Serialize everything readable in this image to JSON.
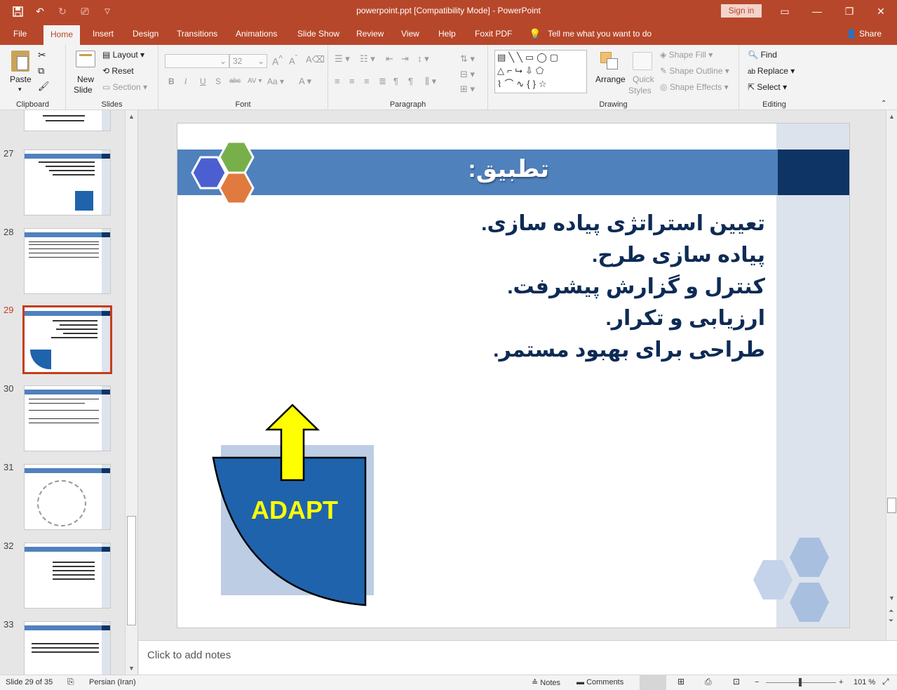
{
  "window": {
    "doc_title": "powerpoint.ppt [Compatibility Mode]  -  PowerPoint",
    "signin": "Sign in"
  },
  "tabs": [
    "File",
    "Home",
    "Insert",
    "Design",
    "Transitions",
    "Animations",
    "Slide Show",
    "Review",
    "View",
    "Help",
    "Foxit PDF",
    "Tell me what you want to do"
  ],
  "share": "Share",
  "ribbon": {
    "clipboard": {
      "paste": "Paste",
      "label": "Clipboard"
    },
    "slides": {
      "new_slide_1": "New",
      "new_slide_2": "Slide",
      "layout": "Layout",
      "reset": "Reset",
      "section": "Section",
      "label": "Slides"
    },
    "font": {
      "size": "32",
      "label": "Font"
    },
    "paragraph": {
      "label": "Paragraph"
    },
    "drawing": {
      "arrange": "Arrange",
      "quick_styles_1": "Quick",
      "quick_styles_2": "Styles",
      "shape_fill": "Shape Fill",
      "shape_outline": "Shape Outline",
      "shape_effects": "Shape Effects",
      "label": "Drawing"
    },
    "editing": {
      "find": "Find",
      "replace": "Replace",
      "select": "Select",
      "label": "Editing"
    }
  },
  "thumbnails": [
    {
      "num": "27"
    },
    {
      "num": "28"
    },
    {
      "num": "29"
    },
    {
      "num": "30"
    },
    {
      "num": "31"
    },
    {
      "num": "32"
    },
    {
      "num": "33"
    }
  ],
  "slide": {
    "title": "تطبیق:",
    "bullets": [
      "تعیین استراتژی پیاده سازی.",
      "پیاده سازی طرح.",
      "کنترل و گزارش پیشرفت.",
      "ارزیابی و تکرار.",
      "طراحی برای بهبود مستمر."
    ],
    "graphic_label": "ADAPT",
    "colors": {
      "band": "#4f81bd",
      "band_dark": "#0d3464",
      "hex_blue": "#4c5fd0",
      "hex_green": "#77b04a",
      "hex_orange": "#e07a3e",
      "adapt_fill": "#1f63ad",
      "arrow": "#ffff00"
    }
  },
  "notes": {
    "placeholder": "Click to add notes"
  },
  "status": {
    "slide_counter": "Slide 29 of 35",
    "language": "Persian (Iran)",
    "notes": "Notes",
    "comments": "Comments",
    "zoom": "101 %"
  }
}
